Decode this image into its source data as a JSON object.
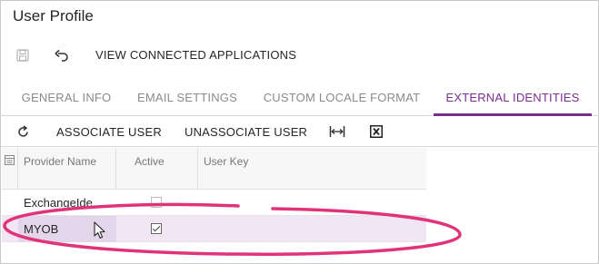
{
  "page": {
    "title": "User Profile"
  },
  "toolbar": {
    "connected_apps_label": "VIEW CONNECTED APPLICATIONS"
  },
  "tabs": [
    {
      "label": "GENERAL INFO",
      "active": false
    },
    {
      "label": "EMAIL SETTINGS",
      "active": false
    },
    {
      "label": "CUSTOM LOCALE FORMAT",
      "active": false
    },
    {
      "label": "EXTERNAL IDENTITIES",
      "active": true
    }
  ],
  "grid_toolbar": {
    "associate_label": "ASSOCIATE USER",
    "unassociate_label": "UNASSOCIATE USER"
  },
  "grid": {
    "columns": [
      "Provider Name",
      "Active",
      "User Key"
    ],
    "rows": [
      {
        "provider": "ExchangeIde…",
        "active": false,
        "user_key": ""
      },
      {
        "provider": "MYOB",
        "active": true,
        "user_key": ""
      }
    ]
  },
  "colors": {
    "accent": "#7a2e8f",
    "highlight": "#e0337a",
    "selected_row": "#f1e6f4"
  }
}
